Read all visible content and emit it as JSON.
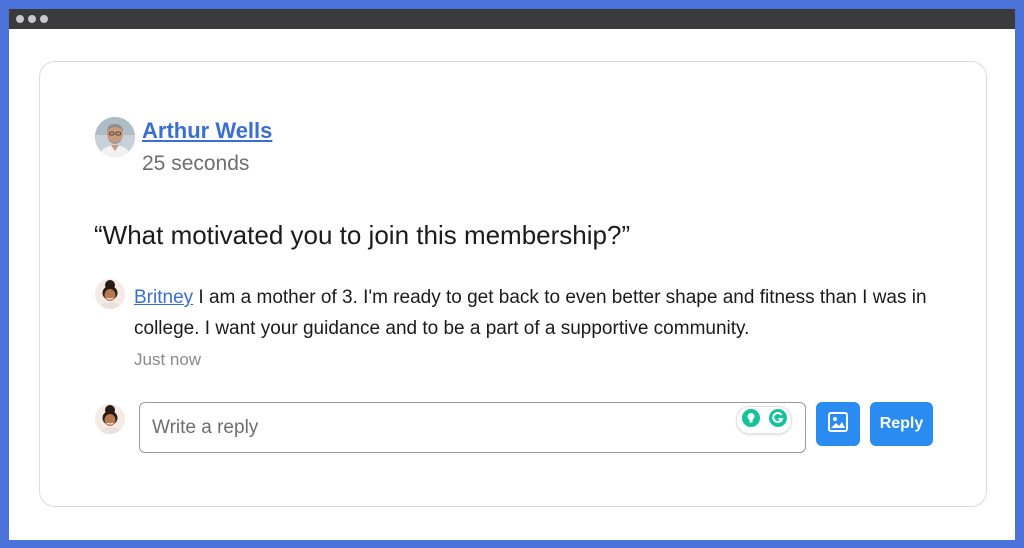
{
  "window": {
    "controls": [
      "dot",
      "dot",
      "dot"
    ]
  },
  "post": {
    "author": "Arthur Wells",
    "time": "25 seconds",
    "question": "“What motivated you to join this membership?”"
  },
  "comment": {
    "author": "Britney",
    "text": "I am a mother of 3. I'm ready to get back to even better shape and fitness than I was in college. I want your guidance and to be a part of a supportive community.",
    "time": "Just now"
  },
  "reply": {
    "placeholder": "Write a reply",
    "value": "",
    "button_label": "Reply",
    "image_button_icon": "image-icon",
    "extension_icons": [
      "lightbulb-icon",
      "grammarly-icon"
    ]
  },
  "colors": {
    "accent": "#2a8cf0",
    "link": "#3a6fd0",
    "frame": "#4a72d8",
    "grammarly": "#15c39a"
  }
}
